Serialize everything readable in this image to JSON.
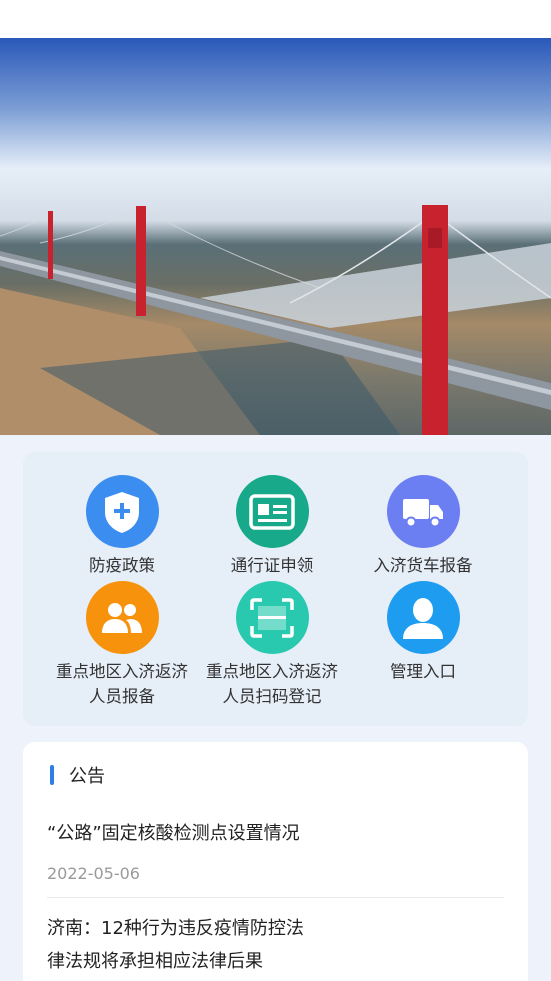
{
  "colors": {
    "accent": "#2f7ee8",
    "policy": "#3b8df0",
    "pass": "#17a98a",
    "truck": "#6b7ef2",
    "people": "#f7920d",
    "scan": "#29c9b0",
    "admin": "#1e9cf0"
  },
  "menu": [
    {
      "icon": "shield-plus-icon",
      "label_lines": [
        "防疫政策"
      ]
    },
    {
      "icon": "id-card-icon",
      "label_lines": [
        "通行证申领"
      ]
    },
    {
      "icon": "truck-icon",
      "label_lines": [
        "入济货车报备"
      ]
    },
    {
      "icon": "people-icon",
      "label_lines": [
        "重点地区入济返济",
        "人员报备"
      ]
    },
    {
      "icon": "scan-icon",
      "label_lines": [
        "重点地区入济返济",
        "人员扫码登记"
      ]
    },
    {
      "icon": "user-icon",
      "label_lines": [
        "管理入口"
      ]
    }
  ],
  "notice": {
    "title": "公告",
    "items": [
      {
        "title": "“公路”固定核酸检测点设置情况",
        "date": "2022-05-06"
      },
      {
        "title_lines": [
          "济南：12种行为违反疫情防控法",
          "律法规将承担相应法律后果"
        ]
      }
    ]
  }
}
